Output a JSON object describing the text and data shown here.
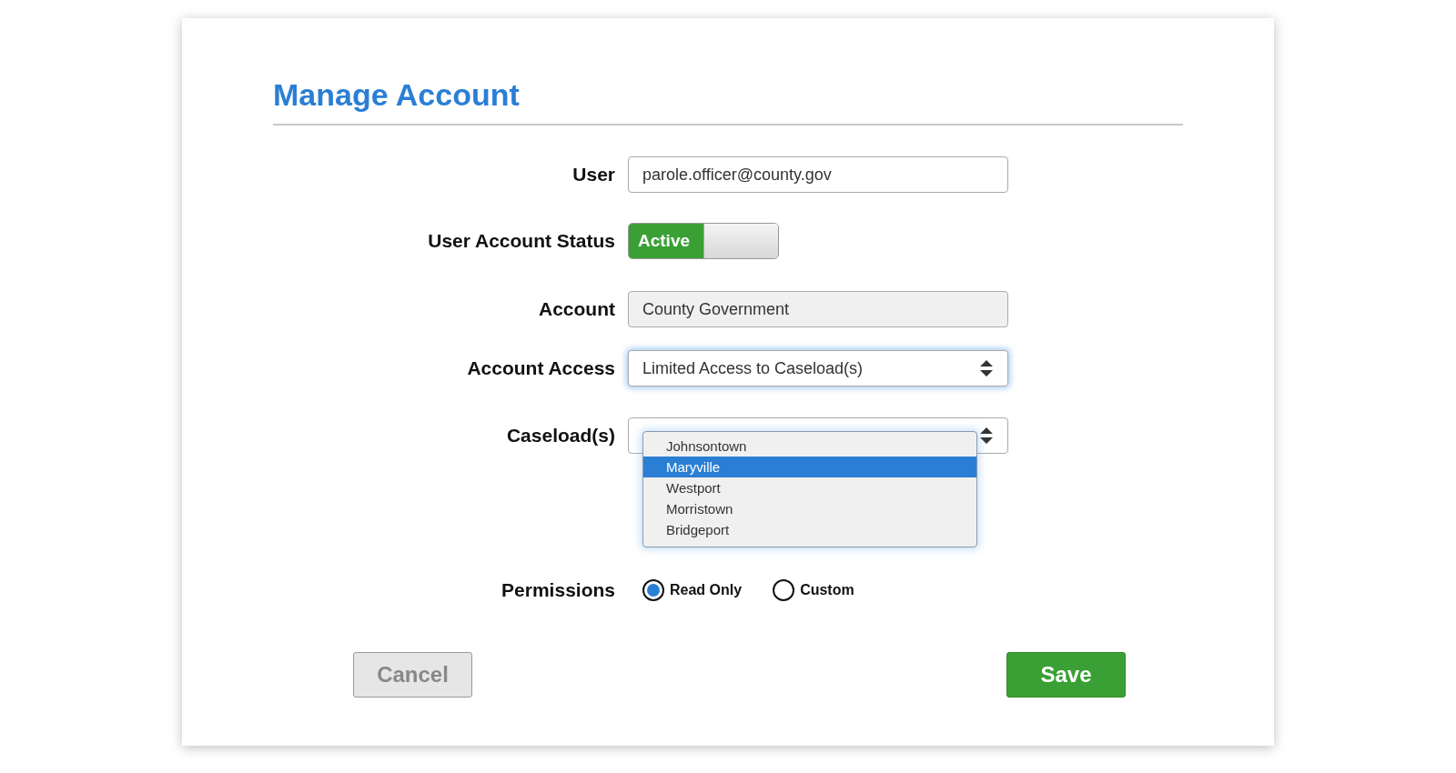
{
  "title": "Manage Account",
  "form": {
    "user": {
      "label": "User",
      "value": "parole.officer@county.gov"
    },
    "status": {
      "label": "User Account Status",
      "toggle_label": "Active",
      "on": true
    },
    "account": {
      "label": "Account",
      "value": "County Government",
      "disabled": true
    },
    "account_access": {
      "label": "Account Access",
      "value": "Limited Access to Caseload(s)",
      "focused": true
    },
    "caseloads": {
      "label": "Caseload(s)",
      "options": [
        {
          "label": "Johnsontown",
          "selected": false
        },
        {
          "label": "Maryville",
          "selected": true
        },
        {
          "label": "Westport",
          "selected": false
        },
        {
          "label": "Morristown",
          "selected": false
        },
        {
          "label": "Bridgeport",
          "selected": false
        }
      ]
    },
    "permissions": {
      "label": "Permissions",
      "options": [
        {
          "label": "Read Only",
          "selected": true
        },
        {
          "label": "Custom",
          "selected": false
        }
      ]
    }
  },
  "buttons": [
    {
      "label": "Cancel",
      "kind": "secondary"
    },
    {
      "label": "Save",
      "kind": "primary"
    }
  ]
}
